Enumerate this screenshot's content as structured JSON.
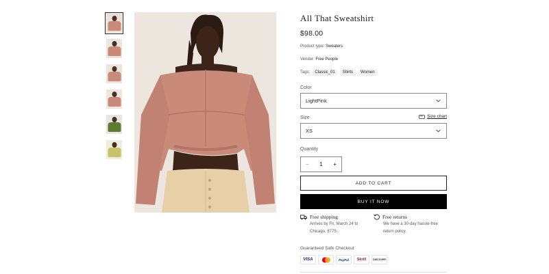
{
  "product": {
    "title": "All That Sweatshirt",
    "price": "$98.00",
    "type_label": "Product type:",
    "type_value": "Sweaters",
    "vendor_label": "Vendor:",
    "vendor_value": "Free People",
    "tags_label": "Tags:",
    "tags": [
      "Classic_01",
      "Shirts",
      "Women"
    ]
  },
  "gallery": {
    "thumbnails": [
      {
        "bg": "#e9e1d8",
        "fig": "#c98a7a"
      },
      {
        "bg": "#ebe5de",
        "fig": "#c98a7a"
      },
      {
        "bg": "#ebe5de",
        "fig": "#c98a7a"
      },
      {
        "bg": "#ece7e0",
        "fig": "#c98a7a"
      },
      {
        "bg": "#e7e7e0",
        "fig": "#5c7a32"
      },
      {
        "bg": "#eeeedd",
        "fig": "#c9c26a"
      }
    ],
    "active_index": 0
  },
  "options": {
    "color_label": "Color",
    "color_value": "LightPink",
    "size_label": "Size",
    "size_value": "XS",
    "size_chart": "Size chart",
    "quantity_label": "Quantity",
    "quantity_value": "1",
    "minus": "−",
    "plus": "+"
  },
  "actions": {
    "add_to_cart": "ADD TO CART",
    "buy_now": "BUY IT NOW"
  },
  "perks": {
    "shipping_title": "Free shipping",
    "shipping_text": "Arrives by Fri, March 24 to Chicago, 8775.",
    "returns_title": "Free returns",
    "returns_text": "We have a 30-day hassle-free return policy."
  },
  "checkout": {
    "label": "Guaranteed Safe Checkout",
    "methods": [
      {
        "name": "VISA",
        "color": "#1a1f71"
      },
      {
        "name": "mastercard",
        "color": "#eb001b"
      },
      {
        "name": "PayPal",
        "color": "#003087"
      },
      {
        "name": "Skrill",
        "color": "#862165"
      },
      {
        "name": "DISCOVER",
        "color": "#e65c00"
      }
    ]
  },
  "colors": {
    "sweatshirt": "#c98a7a",
    "skirt": "#e7cfa8",
    "background": "#ebe4dc",
    "buy_button": "#000000"
  }
}
